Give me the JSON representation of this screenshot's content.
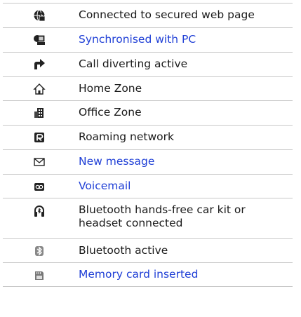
{
  "rows": [
    {
      "icon": "secured-web-globe-icon",
      "text": "Connected to secured web page",
      "link": false
    },
    {
      "icon": "pc-sync-icon",
      "text": "Synchronised with PC",
      "link": true
    },
    {
      "icon": "call-divert-arrow-icon",
      "text": "Call diverting active",
      "link": false
    },
    {
      "icon": "home-zone-icon",
      "text": "Home Zone",
      "link": false
    },
    {
      "icon": "office-zone-icon",
      "text": "Office Zone",
      "link": false
    },
    {
      "icon": "roaming-r-icon",
      "text": "Roaming network",
      "link": false
    },
    {
      "icon": "envelope-icon",
      "text": "New message",
      "link": true
    },
    {
      "icon": "voicemail-icon",
      "text": "Voicemail",
      "link": true
    },
    {
      "icon": "bluetooth-headset-icon",
      "text": "Bluetooth hands-free car kit or headset connected",
      "link": false
    },
    {
      "icon": "bluetooth-icon",
      "text": "Bluetooth active",
      "link": false
    },
    {
      "icon": "memory-card-icon",
      "text": "Memory card inserted",
      "link": true
    }
  ],
  "colors": {
    "link": "#1f3fd6",
    "text": "#1a1a1a",
    "rule": "#c8c8c8"
  }
}
